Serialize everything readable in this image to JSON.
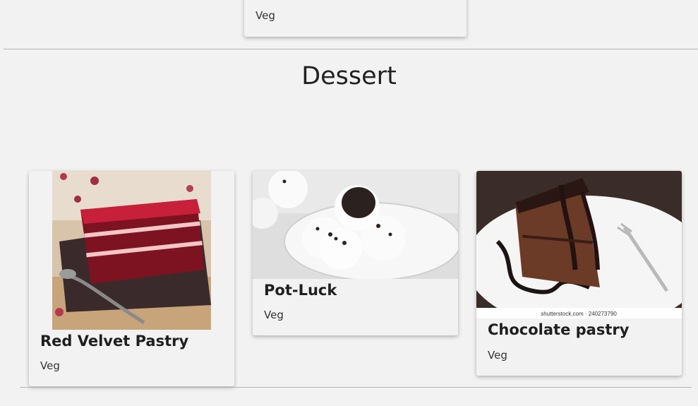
{
  "top_card": {
    "tag": "Veg"
  },
  "section": {
    "title": "Dessert"
  },
  "cards": [
    {
      "title": "Red Velvet Pastry",
      "tag": "Veg",
      "image_alt": "red-velvet-pastry-photo"
    },
    {
      "title": "Pot-Luck",
      "tag": "Veg",
      "image_alt": "cake-balls-photo"
    },
    {
      "title": "Chocolate pastry",
      "tag": "Veg",
      "image_alt": "chocolate-pastry-photo",
      "watermark": "shutterstock.com · 240273790"
    }
  ]
}
